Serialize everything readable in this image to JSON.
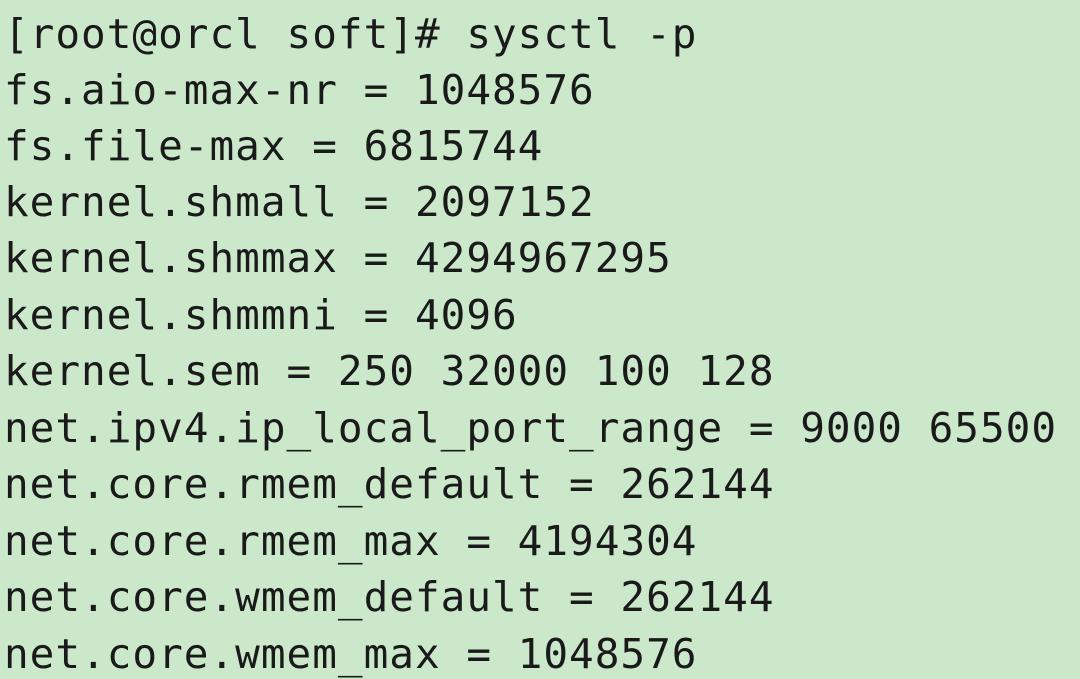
{
  "terminal": {
    "background": "#cbe8cb",
    "text_color": "#1a1a1a",
    "lines": [
      "[root@orcl soft]# sysctl -p",
      "fs.aio-max-nr = 1048576",
      "fs.file-max = 6815744",
      "kernel.shmall = 2097152",
      "kernel.shmmax = 4294967295",
      "kernel.shmmni = 4096",
      "kernel.sem = 250 32000 100 128",
      "net.ipv4.ip_local_port_range = 9000 65500",
      "net.core.rmem_default = 262144",
      "net.core.rmem_max = 4194304",
      "net.core.wmem_default = 262144",
      "net.core.wmem_max = 1048576"
    ]
  }
}
